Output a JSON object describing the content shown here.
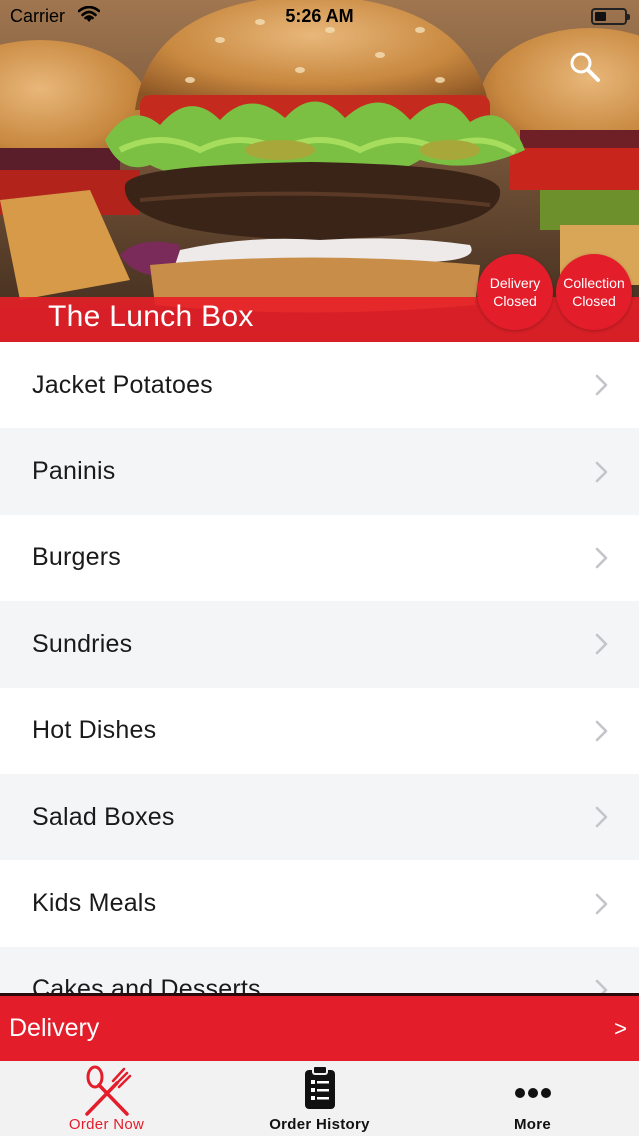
{
  "status_bar": {
    "carrier": "Carrier",
    "time": "5:26 AM",
    "battery_level": 0.4
  },
  "header": {
    "restaurant_name": "The Lunch Box",
    "search_icon": "search-icon",
    "delivery_badge": {
      "line1": "Delivery",
      "line2": "Closed"
    },
    "collection_badge": {
      "line1": "Collection",
      "line2": "Closed"
    }
  },
  "menu": {
    "categories": [
      {
        "label": "Jacket Potatoes"
      },
      {
        "label": "Paninis"
      },
      {
        "label": "Burgers"
      },
      {
        "label": "Sundries"
      },
      {
        "label": "Hot Dishes"
      },
      {
        "label": "Salad Boxes"
      },
      {
        "label": "Kids Meals"
      },
      {
        "label": "Cakes and Desserts"
      }
    ]
  },
  "delivery_bar": {
    "label": "Delivery",
    "arrow": ">"
  },
  "tab_bar": {
    "tabs": [
      {
        "label": "Order Now",
        "icon": "fork-knife-icon",
        "active": true
      },
      {
        "label": "Order History",
        "icon": "clipboard-list-icon",
        "active": false
      },
      {
        "label": "More",
        "icon": "more-dots-icon",
        "active": false
      }
    ]
  },
  "colors": {
    "accent": "#e41d2b",
    "alt_row": "#f4f5f7",
    "tab_bar_bg": "#f2f2f2"
  }
}
